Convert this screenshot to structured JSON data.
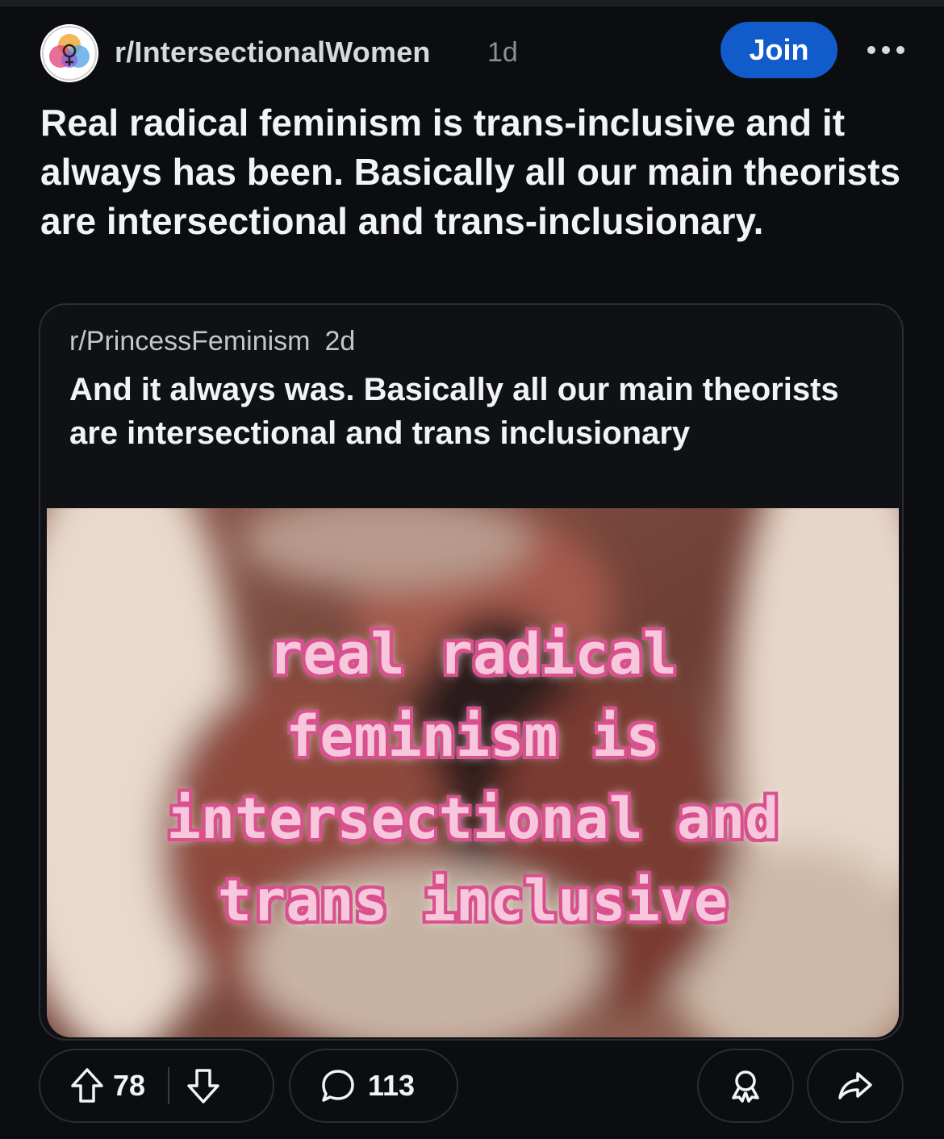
{
  "post": {
    "subreddit": "r/IntersectionalWomen",
    "age": "1d",
    "join_label": "Join",
    "title": "Real radical feminism is trans-inclusive and it always has been. Basically all our main theorists are intersectional and trans-inclusionary."
  },
  "crosspost": {
    "subreddit": "r/PrincessFeminism",
    "age": "2d",
    "title": "And it always was. Basically all our main theorists are intersectional and trans inclusionary",
    "image_caption": {
      "line1": "real radical",
      "line2": "feminism is",
      "line3": "intersectional and",
      "line4": "trans inclusive"
    }
  },
  "actions": {
    "upvotes": "78",
    "comments": "113"
  },
  "icons": {
    "avatar": "community-logo-icon",
    "more": "more-horizontal-icon",
    "upvote": "upvote-arrow-icon",
    "downvote": "downvote-arrow-icon",
    "comment": "comment-bubble-icon",
    "award": "award-icon",
    "share": "share-arrow-icon"
  },
  "colors": {
    "background": "#0b0d10",
    "join": "#115bca",
    "caption_fill": "#f7c8dc",
    "caption_outline": "#d9508f"
  }
}
